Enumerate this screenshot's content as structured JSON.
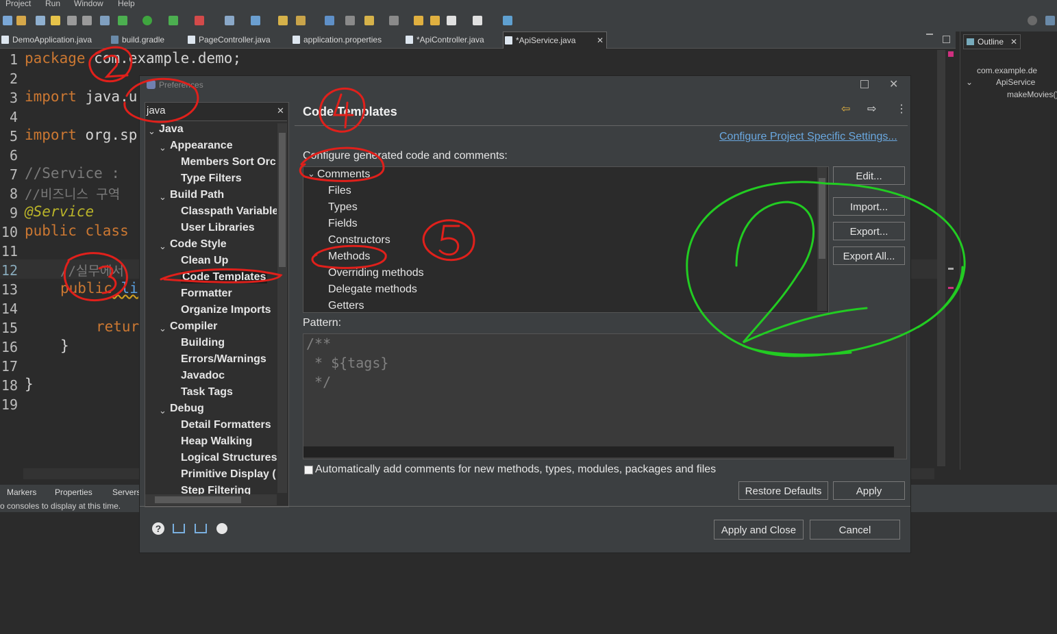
{
  "menu": [
    "Project",
    "Run",
    "Window",
    "Help"
  ],
  "tabs": [
    {
      "label": "DemoApplication.java"
    },
    {
      "label": "build.gradle"
    },
    {
      "label": "PageController.java"
    },
    {
      "label": "application.properties"
    },
    {
      "label": "*ApiController.java"
    },
    {
      "label": "*ApiService.java"
    }
  ],
  "editor": {
    "line_numbers": [
      "1",
      "2",
      "3",
      "4",
      "5",
      "6",
      "7",
      "8",
      "9",
      "10",
      "11",
      "12",
      "13",
      "14",
      "15",
      "16",
      "17",
      "18",
      "19"
    ],
    "l1_kw": "package",
    "l1_rest": " com.example.demo;",
    "l3_kw": "import",
    "l3_rest": " java.u",
    "l5_kw": "import",
    "l5_rest": " org.sp",
    "l7": "//Service : ",
    "l8": "//비즈니스 구역",
    "l9": "@Service",
    "l10": "public class",
    "l12": "//실무에서",
    "l13_kw": "public",
    "l13_rest": " li",
    "l15": "retur",
    "l16": "}",
    "l18": "}"
  },
  "outline": {
    "tab_label": "Outline",
    "items": [
      "com.example.de",
      "ApiService",
      "makeMovies()"
    ]
  },
  "bottom": {
    "tabs": [
      "Markers",
      "Properties",
      "Servers"
    ],
    "status": "o consoles to display at this time."
  },
  "dialog": {
    "title": "Preferences",
    "filter_value": "java",
    "tree": [
      "Java",
      "Appearance",
      "Members Sort Orc",
      "Type Filters",
      "Build Path",
      "Classpath Variable",
      "User Libraries",
      "Code Style",
      "Clean Up",
      "Code Templates",
      "Formatter",
      "Organize Imports",
      "Compiler",
      "Building",
      "Errors/Warnings",
      "Javadoc",
      "Task Tags",
      "Debug",
      "Detail Formatters",
      "Heap Walking",
      "Logical Structures",
      "Primitive Display (",
      "Step Filtering"
    ],
    "page_title": "Code Templates",
    "project_link": "Configure Project Specific Settings...",
    "configure_label": "Configure generated code and comments:",
    "templates": [
      "Comments",
      "Files",
      "Types",
      "Fields",
      "Constructors",
      "Methods",
      "Overriding methods",
      "Delegate methods",
      "Getters"
    ],
    "buttons": {
      "edit": "Edit...",
      "import": "Import...",
      "export": "Export...",
      "export_all": "Export All...",
      "restore": "Restore Defaults",
      "apply": "Apply",
      "apply_close": "Apply and Close",
      "cancel": "Cancel"
    },
    "pattern_label": "Pattern:",
    "pattern_lines": [
      "/**",
      " * ${tags}",
      " */"
    ],
    "auto_comments": "Automatically add comments for new methods, types, modules, packages and files"
  },
  "colors": {
    "annotation_red": "#e0201b",
    "annotation_green": "#22cc22",
    "keyword": "#cc7832"
  }
}
